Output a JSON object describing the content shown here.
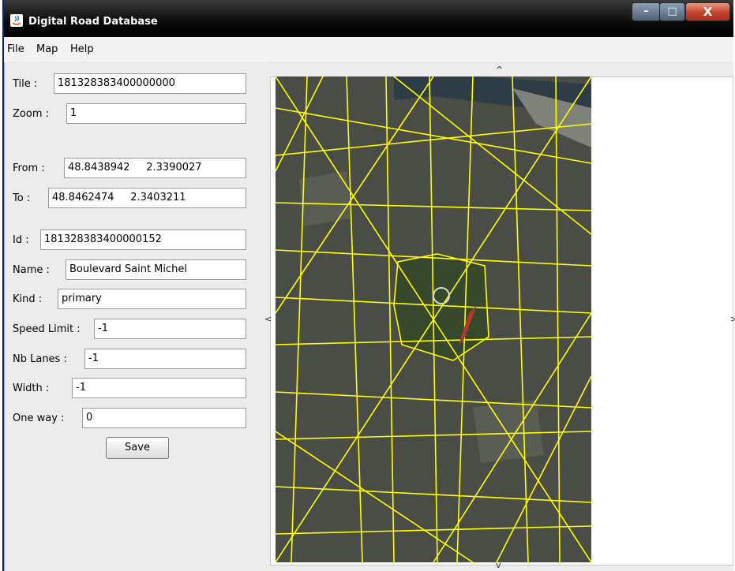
{
  "window": {
    "title": "Digital Road Database",
    "controls": {
      "minimize": "–",
      "maximize": "□",
      "close": "X"
    }
  },
  "menu": [
    "File",
    "Map",
    "Help"
  ],
  "form": {
    "tile": {
      "label": "Tile :",
      "value": "181328383400000000"
    },
    "zoom": {
      "label": "Zoom :",
      "value": "1"
    },
    "from": {
      "label": "From :",
      "value": "48.8438942     2.3390027"
    },
    "to": {
      "label": "To :",
      "value": "48.8462474     2.3403211"
    },
    "id": {
      "label": "Id :",
      "value": "181328383400000152"
    },
    "name": {
      "label": "Name :",
      "value": "Boulevard Saint Michel"
    },
    "kind": {
      "label": "Kind :",
      "value": "primary"
    },
    "speed_limit": {
      "label": "Speed Limit :",
      "value": "-1"
    },
    "nb_lanes": {
      "label": "Nb Lanes :",
      "value": "-1"
    },
    "width": {
      "label": "Width :",
      "value": "-1"
    },
    "one_way": {
      "label": "One way :",
      "value": "0"
    },
    "save_label": "Save"
  },
  "map": {
    "nav": {
      "up": "^",
      "down": "v",
      "left": "<",
      "right": ">"
    },
    "colors": {
      "road": "#ffff00",
      "selected_road": "#b03a2e",
      "aerial_base": "#4a4d45",
      "aerial_park": "#38482c",
      "aerial_river": "#2e3d45"
    },
    "icons": [
      "app-java-icon"
    ]
  }
}
